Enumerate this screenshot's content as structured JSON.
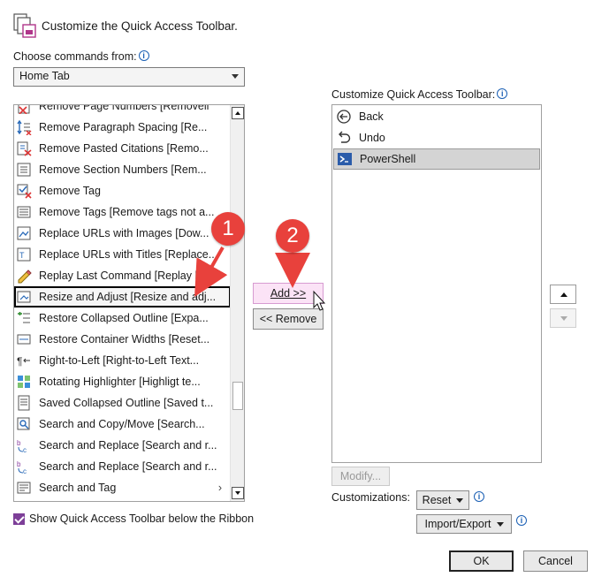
{
  "header": {
    "title": "Customize the Quick Access Toolbar.",
    "icon": "customize-toolbar-icon"
  },
  "choose": {
    "label": "Choose commands from:",
    "selected": "Home Tab"
  },
  "commands": [
    {
      "label": "Remove Page Numbers [Removell",
      "icon": "page-numbers-icon"
    },
    {
      "label": "Remove Paragraph Spacing [Re...",
      "icon": "paragraph-spacing-icon"
    },
    {
      "label": "Remove Pasted Citations [Remo...",
      "icon": "citations-remove-icon"
    },
    {
      "label": "Remove Section Numbers [Rem...",
      "icon": "section-numbers-icon"
    },
    {
      "label": "Remove Tag",
      "icon": "tag-remove-icon"
    },
    {
      "label": "Remove Tags [Remove tags not a...",
      "icon": "tags-remove-icon"
    },
    {
      "label": "Replace URLs with Images [Dow...",
      "icon": "url-image-icon"
    },
    {
      "label": "Replace URLs with Titles [Replace...",
      "icon": "url-title-icon"
    },
    {
      "label": "Replay Last Command [Replay la...",
      "icon": "replay-icon"
    },
    {
      "label": "Resize and Adjust [Resize and adj...",
      "icon": "resize-icon"
    },
    {
      "label": "Restore Collapsed Outline [Expa...",
      "icon": "outline-restore-icon"
    },
    {
      "label": "Restore Container Widths [Reset...",
      "icon": "container-widths-icon"
    },
    {
      "label": "Right-to-Left [Right-to-Left Text...",
      "icon": "rtl-icon"
    },
    {
      "label": "Rotating Highlighter [Highligt te...",
      "icon": "highlighter-icon"
    },
    {
      "label": "Saved Collapsed Outline [Saved t...",
      "icon": "saved-outline-icon"
    },
    {
      "label": "Search and Copy/Move [Search...",
      "icon": "search-copy-icon"
    },
    {
      "label": "Search and Replace [Search and r...",
      "icon": "search-replace-icon"
    },
    {
      "label": "Search and Replace [Search and r...",
      "icon": "search-replace-icon"
    },
    {
      "label": "Search and Tag",
      "icon": "search-tag-icon",
      "has_submenu": true
    }
  ],
  "buttons": {
    "add": "Add >>",
    "remove": "<< Remove",
    "modify": "Modify...",
    "reset": "Reset",
    "import_export": "Import/Export",
    "ok": "OK",
    "cancel": "Cancel"
  },
  "qat": {
    "label": "Customize Quick Access Toolbar:",
    "items": [
      {
        "label": "Back",
        "icon": "back-icon"
      },
      {
        "label": "Undo",
        "icon": "undo-icon"
      },
      {
        "label": "PowerShell",
        "icon": "powershell-icon"
      }
    ]
  },
  "customizations_label": "Customizations:",
  "show_below_ribbon": {
    "label": "Show Quick Access Toolbar below the Ribbon",
    "checked": true
  },
  "callouts": [
    "1",
    "2"
  ],
  "colors": {
    "callout": "#e8413c",
    "checkbox": "#7d3f98",
    "add_button": "#fbe3f6"
  }
}
